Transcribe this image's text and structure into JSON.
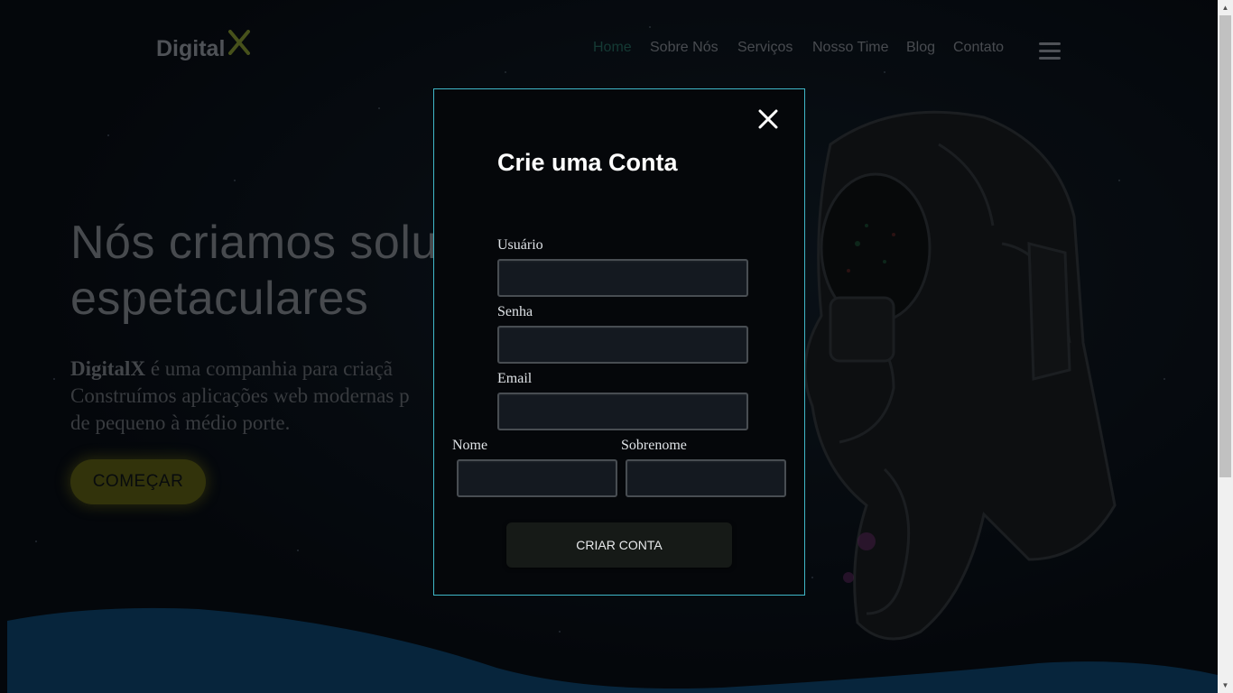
{
  "brand": {
    "name": "Digital",
    "mark": "X"
  },
  "nav": {
    "items": [
      {
        "label": "Home",
        "active": true
      },
      {
        "label": "Sobre Nós"
      },
      {
        "label": "Serviços"
      },
      {
        "label": "Nosso Time"
      },
      {
        "label": "Blog"
      },
      {
        "label": "Contato"
      }
    ]
  },
  "hero": {
    "title_line1": "Nós criamos solu",
    "title_line2": "espetaculares",
    "desc_brand": "DigitalX",
    "desc_line1": " é uma companhia para criaçã",
    "desc_line2": "Construímos aplicações web modernas p",
    "desc_line3": "de pequeno à médio porte.",
    "cta_label": "COMEÇAR"
  },
  "modal": {
    "title": "Crie uma Conta",
    "fields": {
      "usuario": {
        "label": "Usuário",
        "value": ""
      },
      "senha": {
        "label": "Senha",
        "value": ""
      },
      "email": {
        "label": "Email",
        "value": ""
      },
      "nome": {
        "label": "Nome",
        "value": ""
      },
      "sobrenome": {
        "label": "Sobrenome",
        "value": ""
      }
    },
    "submit_label": "CRIAR CONTA"
  },
  "colors": {
    "accent": "#9cb53a",
    "nav_active": "#1f5a51",
    "modal_border": "#3fb7c8",
    "wave": "#0c3a5c"
  },
  "icons": {
    "close": "close-icon",
    "menu": "hamburger-menu-icon",
    "scroll_up": "arrow-up-icon",
    "scroll_down": "arrow-down-icon"
  }
}
